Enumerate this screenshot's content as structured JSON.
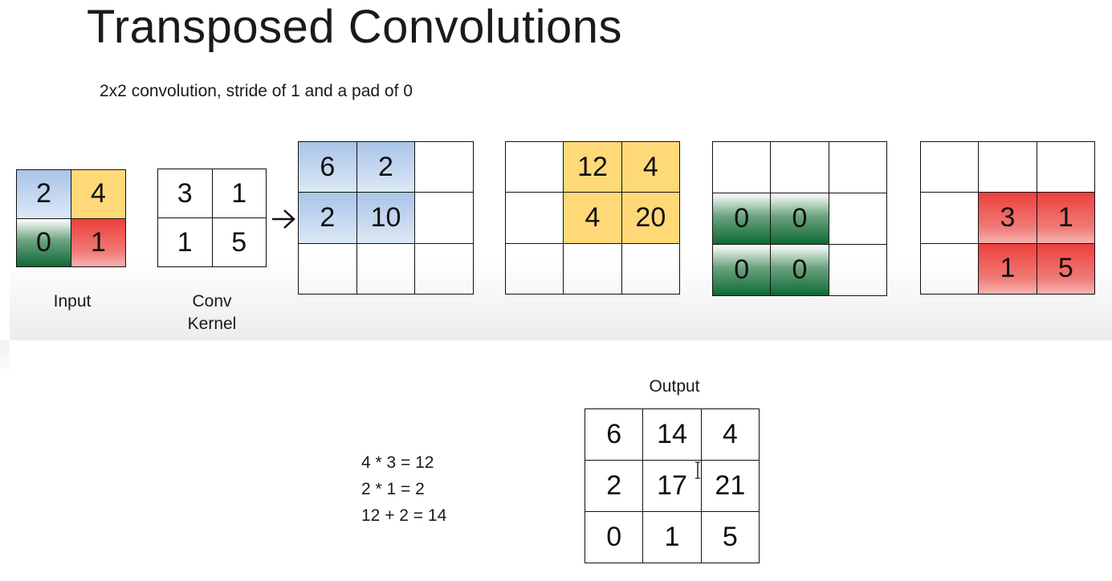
{
  "title": "Transposed Convolutions",
  "subtitle": "2x2 convolution, stride of 1 and a pad of 0",
  "input": {
    "label": "Input",
    "cells": [
      "2",
      "4",
      "0",
      "1"
    ],
    "colors": {
      "top_left": "#a9c4e8",
      "top_right": "#ffd978",
      "bottom_left": "#0e6a35",
      "bottom_right": "#ee3f3b"
    }
  },
  "kernel": {
    "label_line1": "Conv",
    "label_line2": "Kernel",
    "cells": [
      "3",
      "1",
      "1",
      "5"
    ]
  },
  "partials": [
    [
      "6",
      "2",
      "",
      "2",
      "10",
      "",
      "",
      "",
      ""
    ],
    [
      "",
      "12",
      "4",
      "",
      "4",
      "20",
      "",
      "",
      ""
    ],
    [
      "",
      "",
      "",
      "0",
      "0",
      "",
      "0",
      "0",
      ""
    ],
    [
      "",
      "",
      "",
      "",
      "3",
      "1",
      "",
      "1",
      "5"
    ]
  ],
  "output": {
    "label": "Output",
    "cells": [
      "6",
      "14",
      "4",
      "2",
      "17",
      "21",
      "0",
      "1",
      "5"
    ]
  },
  "calculation": [
    "4 * 3 = 12",
    "2 * 1 = 2",
    "12 + 2 = 14"
  ]
}
